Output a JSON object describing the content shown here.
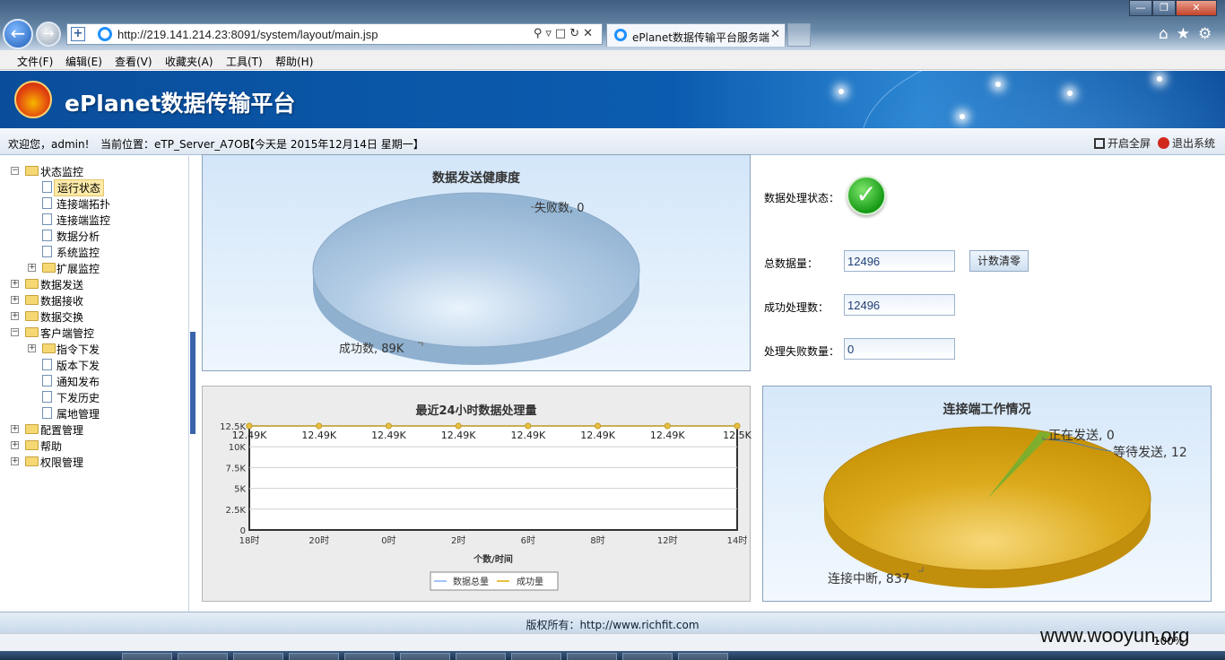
{
  "browser": {
    "url": "http://219.141.214.23:8091/system/layout/main.jsp",
    "tab_title": "ePlanet数据传输平台服务端",
    "zoom": "100%"
  },
  "menubar": [
    "文件(F)",
    "编辑(E)",
    "查看(V)",
    "收藏夹(A)",
    "工具(T)",
    "帮助(H)"
  ],
  "app": {
    "title": "ePlanet数据传输平台",
    "welcome": "欢迎您，admin!",
    "location": "当前位置：eTP_Server_A7OB",
    "date": "【今天是 2015年12月14日 星期一】",
    "fullscreen_label": "开启全屏",
    "logout_label": "退出系统",
    "copyright": "版权所有：http://www.richfit.com"
  },
  "sidebar": {
    "status_monitor": "状态监控",
    "run_status": "运行状态",
    "conn_topology": "连接端拓扑",
    "conn_monitor": "连接端监控",
    "data_analysis": "数据分析",
    "sys_monitor": "系统监控",
    "ext_monitor": "扩展监控",
    "data_send": "数据发送",
    "data_receive": "数据接收",
    "data_exchange": "数据交换",
    "client_control": "客户端管控",
    "cmd_dispatch": "指令下发",
    "version_dispatch": "版本下发",
    "notice_publish": "通知发布",
    "dispatch_history": "下发历史",
    "property_mgmt": "属地管理",
    "config_mgmt": "配置管理",
    "help": "帮助",
    "permission_mgmt": "权限管理"
  },
  "status_form": {
    "process_status_label": "数据处理状态：",
    "total_label": "总数据量：",
    "total_value": "12496",
    "reset_button": "计数清零",
    "success_label": "成功处理数：",
    "success_value": "12496",
    "fail_label": "处理失败数量：",
    "fail_value": "0"
  },
  "chart_data": [
    {
      "type": "pie",
      "title": "数据发送健康度",
      "slices": [
        {
          "label": "成功数",
          "value_label": "89K",
          "value": 89000,
          "color": "#a5c3e0"
        },
        {
          "label": "失败数",
          "value_label": "0",
          "value": 0,
          "color": "#d9534f"
        }
      ]
    },
    {
      "type": "line",
      "title": "最近24小时数据处理量",
      "xlabel": "个数/时间",
      "categories": [
        "18时",
        "20时",
        "0时",
        "2时",
        "6时",
        "8时",
        "12时",
        "14时"
      ],
      "yticks": [
        "0",
        "2.5K",
        "5K",
        "7.5K",
        "10K",
        "12.5K"
      ],
      "ylim": [
        0,
        12500
      ],
      "series": [
        {
          "name": "数据总量",
          "color": "#a0c4ff",
          "values": [
            12496,
            12496,
            12496,
            12496,
            12496,
            12496,
            12496,
            12496
          ]
        },
        {
          "name": "成功量",
          "color": "#e8c040",
          "values": [
            12496,
            12496,
            12496,
            12496,
            12496,
            12496,
            12496,
            12496
          ]
        }
      ],
      "data_labels": [
        "12.49K",
        "12.49K",
        "12.49K",
        "12.49K",
        "12.49K",
        "12.49K",
        "12.49K",
        "12.5K"
      ],
      "legend": "bottom-center"
    },
    {
      "type": "pie",
      "title": "连接端工作情况",
      "slices": [
        {
          "label": "连接中断",
          "value_label": "837",
          "value": 837,
          "color": "#d9a514"
        },
        {
          "label": "等待发送",
          "value_label": "12",
          "value": 12,
          "color": "#7fae2c"
        },
        {
          "label": "正在发送",
          "value_label": "0",
          "value": 0,
          "color": "#4a7ab8"
        }
      ]
    }
  ],
  "watermark": "www.wooyun.org"
}
